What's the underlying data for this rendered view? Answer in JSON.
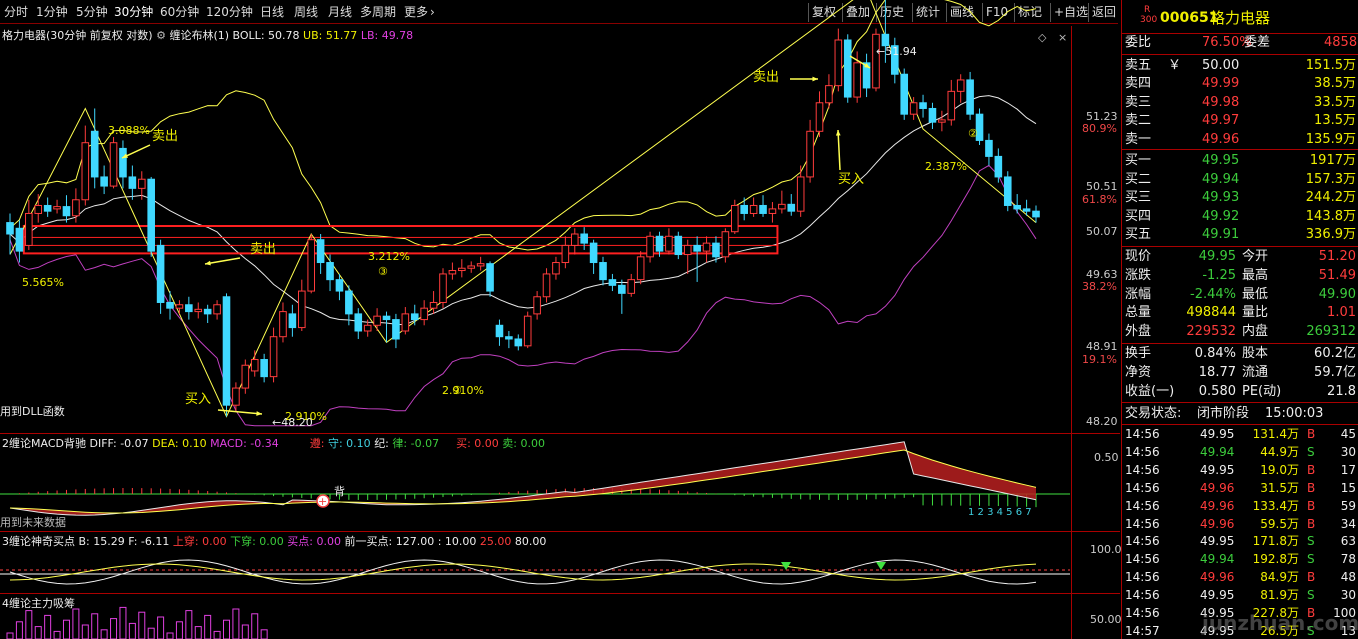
{
  "toolbar": {
    "periods": [
      "分时",
      "1分钟",
      "5分钟",
      "30分钟",
      "60分钟",
      "120分钟",
      "日线",
      "周线",
      "月线",
      "多周期",
      "更多"
    ],
    "active_period": "30分钟",
    "more_arrow": "›",
    "buttons": [
      "复权",
      "叠加",
      "历史",
      "统计",
      "画线",
      "F10",
      "标记",
      "+自选",
      "返回"
    ]
  },
  "main": {
    "title": "格力电器(30分钟 前复权 对数)",
    "indicator_name": "缠论布林(1)",
    "boll": "BOLL: 50.78",
    "ub": "UB: 51.77",
    "lb": "LB: 49.78",
    "dll_text": "用到DLL函数",
    "axis": [
      {
        "price": "51.23",
        "pct": "80.9%"
      },
      {
        "price": "50.51",
        "pct": "61.8%"
      },
      {
        "price": "50.07",
        "pct": ""
      },
      {
        "price": "49.63",
        "pct": "38.2%"
      },
      {
        "price": "48.91",
        "pct": "19.1%"
      },
      {
        "price": "48.20",
        "pct": ""
      }
    ],
    "annotations": {
      "sell1": "卖出",
      "sell2": "卖出",
      "sell3": "卖出",
      "buy1": "买入",
      "buy2": "买入",
      "pct1": "3.088%",
      "pct2": "5.565%",
      "pct3": "3.212%",
      "pct4": "2.910%",
      "pct5": "2.387%",
      "pct6": "2.910%",
      "low_label": "←48.20",
      "high_label": "←51.94",
      "circled3": "③",
      "circled2": "②",
      "circled2b": "②"
    }
  },
  "macd": {
    "title": "2缠论MACD背驰",
    "diff": "DIFF: -0.07",
    "dea": "DEA: 0.10",
    "macd": "MACD: -0.34",
    "fields": [
      "遵:",
      "守: 0.10",
      "纪:",
      "律: -0.07",
      "买: 0.00",
      "卖: 0.00"
    ],
    "axis": "0.50",
    "future_text": "用到未来数据",
    "beichi": "背",
    "digits": "1 2 3 4 5 6 7"
  },
  "panel3": {
    "title": "3缠论神奇买点",
    "b": "B: 15.29",
    "f": "F: -6.11",
    "up": "上穿: 0.00",
    "down": "下穿: 0.00",
    "buy": "买点: 0.00",
    "prev": "前一买点: 127.00 : 10.00",
    "v25": "25.00",
    "v80": "80.00",
    "axis": "100.0"
  },
  "panel4": {
    "title": "4缠论主力吸筹",
    "axis": "50.00"
  },
  "right": {
    "code_prefix": "R",
    "code_sub": "300",
    "code": "000651",
    "name": "格力电器",
    "weibi_label": "委比",
    "weibi": "76.50%",
    "weicha_label": "委差",
    "weicha": "4858",
    "sells": [
      {
        "label": "卖五",
        "mark": "￥",
        "price": "50.00",
        "vol": "151.5万"
      },
      {
        "label": "卖四",
        "mark": "",
        "price": "49.99",
        "vol": "38.5万"
      },
      {
        "label": "卖三",
        "mark": "",
        "price": "49.98",
        "vol": "33.5万"
      },
      {
        "label": "卖二",
        "mark": "",
        "price": "49.97",
        "vol": "13.5万"
      },
      {
        "label": "卖一",
        "mark": "",
        "price": "49.96",
        "vol": "135.9万"
      }
    ],
    "buys": [
      {
        "label": "买一",
        "price": "49.95",
        "vol": "1917万"
      },
      {
        "label": "买二",
        "price": "49.94",
        "vol": "157.3万"
      },
      {
        "label": "买三",
        "price": "49.93",
        "vol": "244.2万"
      },
      {
        "label": "买四",
        "price": "49.92",
        "vol": "143.8万"
      },
      {
        "label": "买五",
        "price": "49.91",
        "vol": "336.9万"
      }
    ],
    "quote": [
      {
        "l1": "现价",
        "v1": "49.95",
        "c1": "grn",
        "l2": "今开",
        "v2": "51.20",
        "c2": "red"
      },
      {
        "l1": "涨跌",
        "v1": "-1.25",
        "c1": "grn",
        "l2": "最高",
        "v2": "51.49",
        "c2": "red"
      },
      {
        "l1": "涨幅",
        "v1": "-2.44%",
        "c1": "grn",
        "l2": "最低",
        "v2": "49.90",
        "c2": "grn"
      },
      {
        "l1": "总量",
        "v1": "498844",
        "c1": "yel",
        "l2": "量比",
        "v2": "1.01",
        "c2": "red"
      },
      {
        "l1": "外盘",
        "v1": "229532",
        "c1": "red",
        "l2": "内盘",
        "v2": "269312",
        "c2": "grn"
      }
    ],
    "quote2": [
      {
        "l1": "换手",
        "v1": "0.84%",
        "l2": "股本",
        "v2": "60.2亿"
      },
      {
        "l1": "净资",
        "v1": "18.77",
        "l2": "流通",
        "v2": "59.7亿"
      },
      {
        "l1": "收益(一)",
        "v1": "0.580",
        "l2": "PE(动)",
        "v2": "21.8"
      }
    ],
    "status_label": "交易状态:",
    "status": "闭市阶段",
    "status_time": "15:00:03",
    "ticks": [
      {
        "t": "14:56",
        "p": "49.95",
        "v": "131.4万",
        "bs": "B",
        "n": "45"
      },
      {
        "t": "14:56",
        "p": "49.94",
        "v": "44.9万",
        "bs": "S",
        "n": "30"
      },
      {
        "t": "14:56",
        "p": "49.95",
        "v": "19.0万",
        "bs": "B",
        "n": "17"
      },
      {
        "t": "14:56",
        "p": "49.96",
        "v": "31.5万",
        "bs": "B",
        "n": "15"
      },
      {
        "t": "14:56",
        "p": "49.96",
        "v": "133.4万",
        "bs": "B",
        "n": "59"
      },
      {
        "t": "14:56",
        "p": "49.96",
        "v": "59.5万",
        "bs": "B",
        "n": "34"
      },
      {
        "t": "14:56",
        "p": "49.95",
        "v": "171.8万",
        "bs": "S",
        "n": "63"
      },
      {
        "t": "14:56",
        "p": "49.94",
        "v": "192.8万",
        "bs": "S",
        "n": "78"
      },
      {
        "t": "14:56",
        "p": "49.96",
        "v": "84.9万",
        "bs": "B",
        "n": "48"
      },
      {
        "t": "14:56",
        "p": "49.95",
        "v": "81.9万",
        "bs": "S",
        "n": "30"
      },
      {
        "t": "14:56",
        "p": "49.95",
        "v": "227.8万",
        "bs": "B",
        "n": "100"
      },
      {
        "t": "14:57",
        "p": "49.95",
        "v": "26.5万",
        "bs": "S",
        "n": "13"
      }
    ],
    "watermark": "junzhuan.com"
  },
  "colors": {
    "up": "#ff3c3c",
    "down": "#40d8ff",
    "mid": "#ffff50",
    "lb": "#c040c0",
    "box": "#ff2020"
  }
}
